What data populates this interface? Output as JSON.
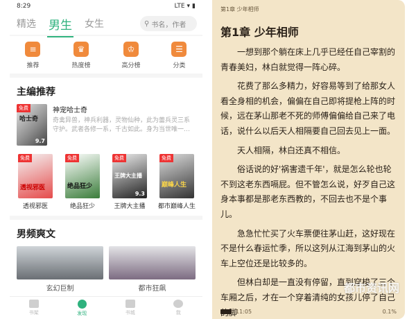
{
  "status_bar": {
    "time": "8:29",
    "network": "LTE"
  },
  "top_tabs": {
    "tab1": "精选",
    "tab2": "男生",
    "tab3": "女生"
  },
  "search": {
    "placeholder": "书名，作者"
  },
  "categories": [
    {
      "label": "推荐",
      "icon": "recommend-icon"
    },
    {
      "label": "热度榜",
      "icon": "trophy-icon"
    },
    {
      "label": "高分榜",
      "icon": "crown-icon"
    },
    {
      "label": "分类",
      "icon": "layers-icon"
    }
  ],
  "editor_section": {
    "title": "主编推荐",
    "featured": {
      "badge": "免费",
      "title": "神宠哈士奇",
      "description": "奇禽异兽，神兵利器，灵物仙种，此为蕾兵灵三系守护。武者各修一系，千古如此。身为当世唯一…",
      "rating": "9.7",
      "cover_text": "哈士奇"
    },
    "books": [
      {
        "badge": "免费",
        "name": "透视邪医",
        "cover_text": "透视邪医",
        "rating": ""
      },
      {
        "badge": "免费",
        "name": "绝品狂少",
        "cover_text": "绝品狂少",
        "rating": ""
      },
      {
        "badge": "免费",
        "name": "王牌大主播",
        "cover_text": "王牌大主播",
        "rating": "9.3"
      },
      {
        "badge": "免费",
        "name": "都市巅峰人生",
        "cover_text": "巅峰人生",
        "rating": ""
      }
    ]
  },
  "male_section": {
    "title": "男频爽文",
    "items": [
      {
        "name": "玄幻巨制"
      },
      {
        "name": "都市狂飙"
      }
    ]
  },
  "bottom_nav": [
    {
      "label": "书架"
    },
    {
      "label": "发现"
    },
    {
      "label": "书城"
    },
    {
      "label": "我"
    }
  ],
  "reader": {
    "header": "第1章 少年相师",
    "chapter_title": "第1章 少年相师",
    "paragraphs": [
      "一想到那个躺在床上几乎已经任自己宰割的青春美妇，林白就觉得一阵心碎。",
      "花费了那么多精力，好容易等到了给那女人看全身相的机会，偏偏在自己即将提枪上阵的时候，远在茅山那老不死的师傅偏偏给自己来了电话，说什么以后天人相隔要自己回去见上一面。",
      "天人相隔，林白还真不相信。",
      "俗话说的好'祸害遗千年'，就是怎么轮也轮不到这老东西嗝屁。但不管怎么说，好歹自己这身本事都是那老东西教的，不回去也不是个事儿。",
      "急急忙忙买了火车票便往茅山赶，这好现在不是什么春运忙季，所以这列从江海到茅山的火车上空位还是比较多的。",
      "但林白却是一直没有停留，直到穿梭了三个车厢之后，才在一个穿着清纯的女孩儿停了自己的脚"
    ],
    "time": "11:05",
    "progress": "0.1%"
  },
  "watermark": "都市资讯网"
}
